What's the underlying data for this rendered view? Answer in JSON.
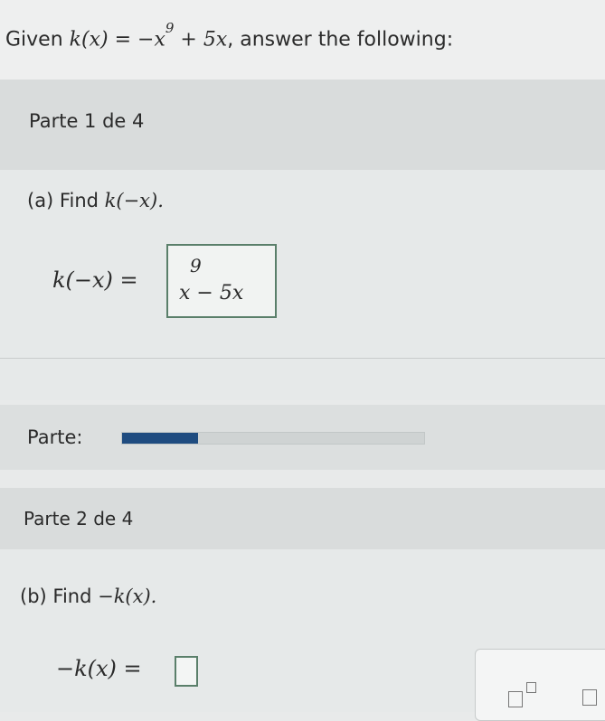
{
  "header": {
    "given": "Given",
    "function_lhs": "k(x)",
    "equals": "=",
    "term1": "−x",
    "exponent": "9",
    "term2": "+ 5x",
    "suffix": ", answer the following:"
  },
  "part1": {
    "label": "Parte 1 de 4",
    "question_label": "(a) Find",
    "question_expr": "k(−x).",
    "answer_lhs": "k(−x) =",
    "answer_base": "x",
    "answer_exponent": "9",
    "answer_rest": " − 5x"
  },
  "progress": {
    "label": "Parte:",
    "value": 0.25
  },
  "part2": {
    "label": "Parte 2 de 4",
    "question_label": "(b) Find",
    "question_expr": "−k(x).",
    "answer_lhs": "−k(x) ="
  },
  "tools": {
    "items": [
      "superscript-template-icon",
      "box-template-icon"
    ]
  }
}
